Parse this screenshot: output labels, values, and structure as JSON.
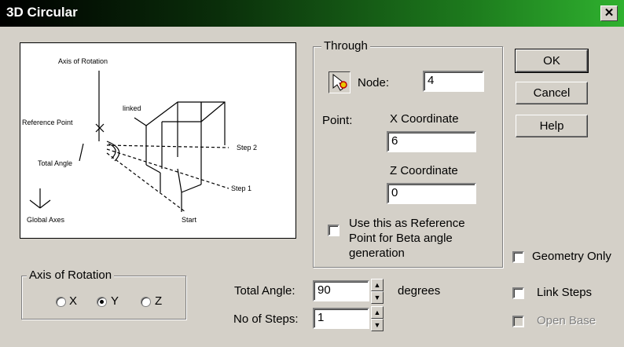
{
  "window": {
    "title": "3D Circular",
    "close_label": "✕"
  },
  "diagram": {
    "axis_of_rotation": "Axis of Rotation",
    "linked": "linked",
    "reference_point": "Reference Point",
    "step2": "Step 2",
    "total_angle": "Total Angle",
    "step1": "Step 1",
    "global_axes": "Global Axes",
    "start": "Start"
  },
  "through": {
    "legend": "Through",
    "node_label": "Node:",
    "node_value": "4",
    "point_label": "Point:",
    "x_label": "X Coordinate",
    "x_value": "6",
    "z_label": "Z Coordinate",
    "z_value": "0",
    "ref_check_label_1": "Use this as Reference",
    "ref_check_label_2": "Point for Beta angle",
    "ref_check_label_3": "generation"
  },
  "buttons": {
    "ok": "OK",
    "cancel": "Cancel",
    "help": "Help"
  },
  "axis": {
    "legend": "Axis of Rotation",
    "x": "X",
    "y": "Y",
    "z": "Z",
    "selected": "Y"
  },
  "params": {
    "total_angle_label": "Total Angle:",
    "total_angle_value": "90",
    "degrees": "degrees",
    "steps_label": "No of Steps:",
    "steps_value": "1"
  },
  "options": {
    "geometry_only": "Geometry Only",
    "link_steps": "Link Steps",
    "open_base": "Open Base"
  },
  "icons": [
    "close-icon",
    "node-pick-icon",
    "spin-up-icon",
    "spin-down-icon"
  ]
}
